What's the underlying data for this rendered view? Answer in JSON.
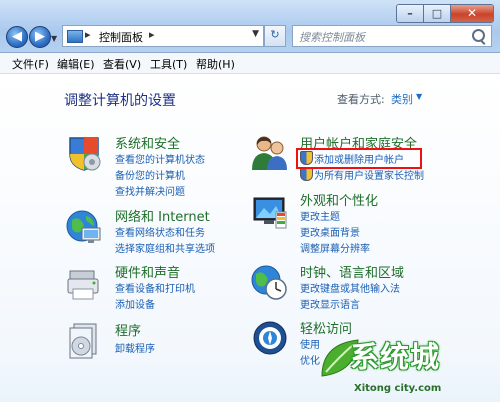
{
  "window": {
    "minimize_icon": "minimize-icon",
    "maximize_icon": "maximize-icon",
    "close_icon": "close-icon"
  },
  "address": {
    "breadcrumb": "控制面板",
    "separator": "▸",
    "search_placeholder": "搜索控制面板"
  },
  "menu": [
    "文件(F)",
    "编辑(E)",
    "查看(V)",
    "工具(T)",
    "帮助(H)"
  ],
  "page": {
    "title": "调整计算机的设置",
    "view_by_label": "查看方式:",
    "view_by_value": "类别"
  },
  "categories_left": [
    {
      "title": "系统和安全",
      "icon": "system-security-icon",
      "links": [
        "查看您的计算机状态",
        "备份您的计算机",
        "查找并解决问题"
      ]
    },
    {
      "title": "网络和 Internet",
      "icon": "network-internet-icon",
      "links": [
        "查看网络状态和任务",
        "选择家庭组和共享选项"
      ]
    },
    {
      "title": "硬件和声音",
      "icon": "hardware-sound-icon",
      "links": [
        "查看设备和打印机",
        "添加设备"
      ]
    },
    {
      "title": "程序",
      "icon": "programs-icon",
      "links": [
        "卸载程序"
      ]
    }
  ],
  "categories_right": [
    {
      "title": "用户帐户和家庭安全",
      "icon": "user-accounts-icon",
      "links": [
        "添加或删除用户帐户",
        "为所有用户设置家长控制"
      ]
    },
    {
      "title": "外观和个性化",
      "icon": "appearance-icon",
      "links": [
        "更改主题",
        "更改桌面背景",
        "调整屏幕分辨率"
      ]
    },
    {
      "title": "时钟、语言和区域",
      "icon": "clock-language-icon",
      "links": [
        "更改键盘或其他输入法",
        "更改显示语言"
      ]
    },
    {
      "title": "轻松访问",
      "icon": "ease-of-access-icon",
      "links": [
        "使用",
        "优化"
      ]
    }
  ],
  "watermark": {
    "main": "系统城",
    "sub": "Xitong city.com"
  },
  "colors": {
    "title_blue": "#1e3287",
    "category_green": "#1e6e2a",
    "link_blue": "#1a5fb4",
    "highlight_red": "#ee1111"
  }
}
